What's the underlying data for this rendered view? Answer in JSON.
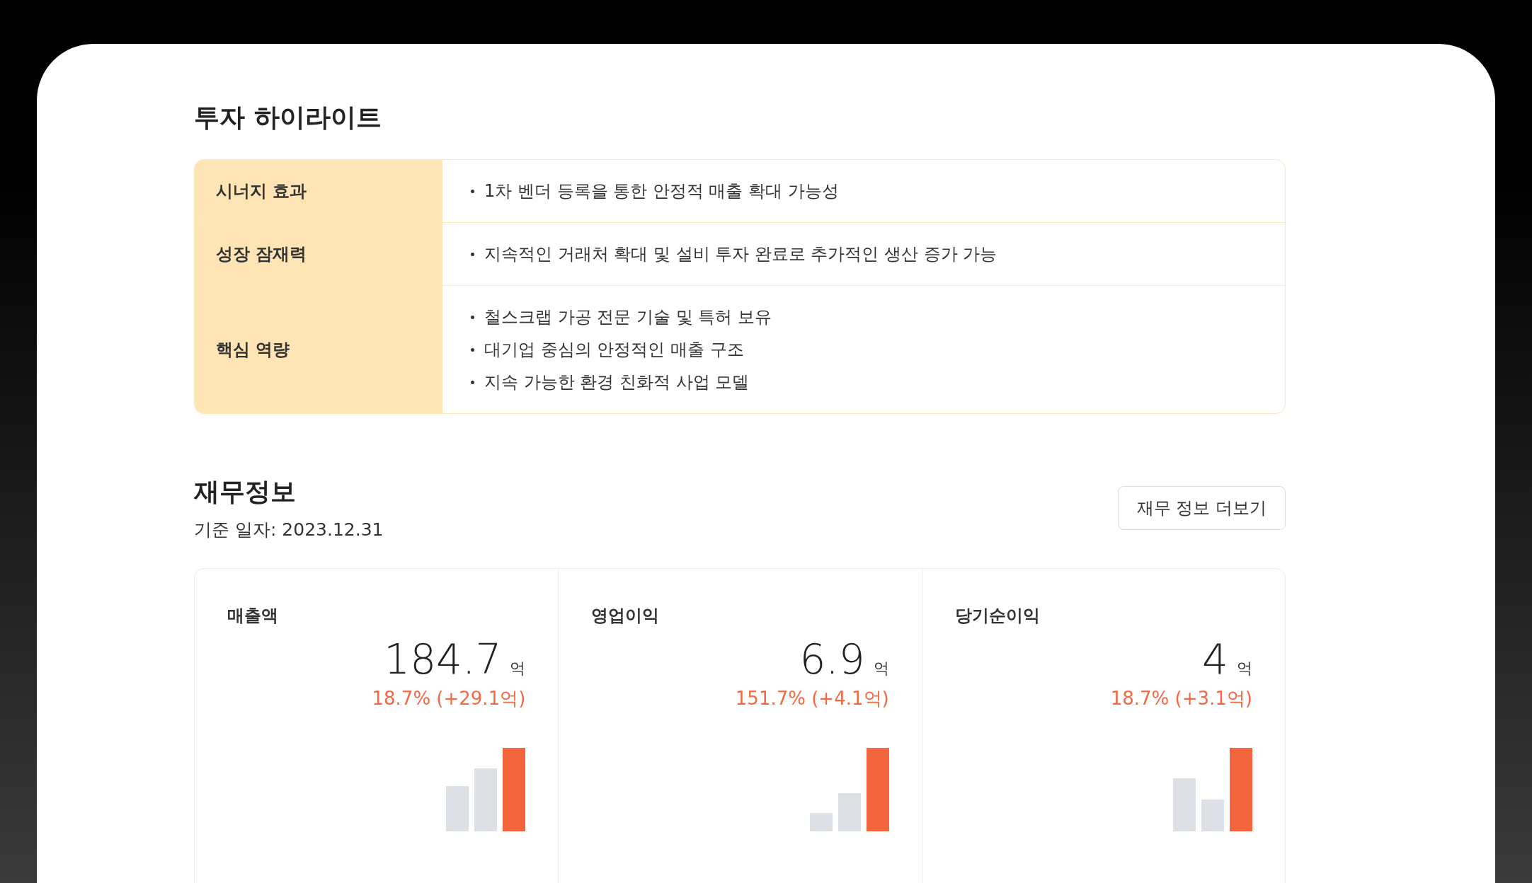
{
  "highlights": {
    "title": "투자 하이라이트",
    "rows": [
      {
        "label": "시너지 효과",
        "bullets": [
          "1차 벤더 등록을 통한 안정적 매출 확대 가능성"
        ]
      },
      {
        "label": "성장 잠재력",
        "bullets": [
          "지속적인 거래처 확대 및 설비 투자 완료로 추가적인 생산 증가 가능"
        ]
      },
      {
        "label": "핵심 역량",
        "bullets": [
          "철스크랩 가공 전문 기술 및 특허 보유",
          "대기업 중심의 안정적인 매출 구조",
          "지속 가능한 환경 친화적 사업 모델"
        ]
      }
    ]
  },
  "financials": {
    "title": "재무정보",
    "date": "기준 일자: 2023.12.31",
    "more_button": "재무 정보 더보기",
    "cards": [
      {
        "label": "매출액",
        "value": "184.7",
        "unit": "억",
        "change": "18.7% (+29.1억)"
      },
      {
        "label": "영업이익",
        "value": "6.9",
        "unit": "억",
        "change": "151.7% (+4.1억)"
      },
      {
        "label": "당기순이익",
        "value": "4",
        "unit": "억",
        "change": "18.7% (+3.1억)"
      }
    ]
  }
}
